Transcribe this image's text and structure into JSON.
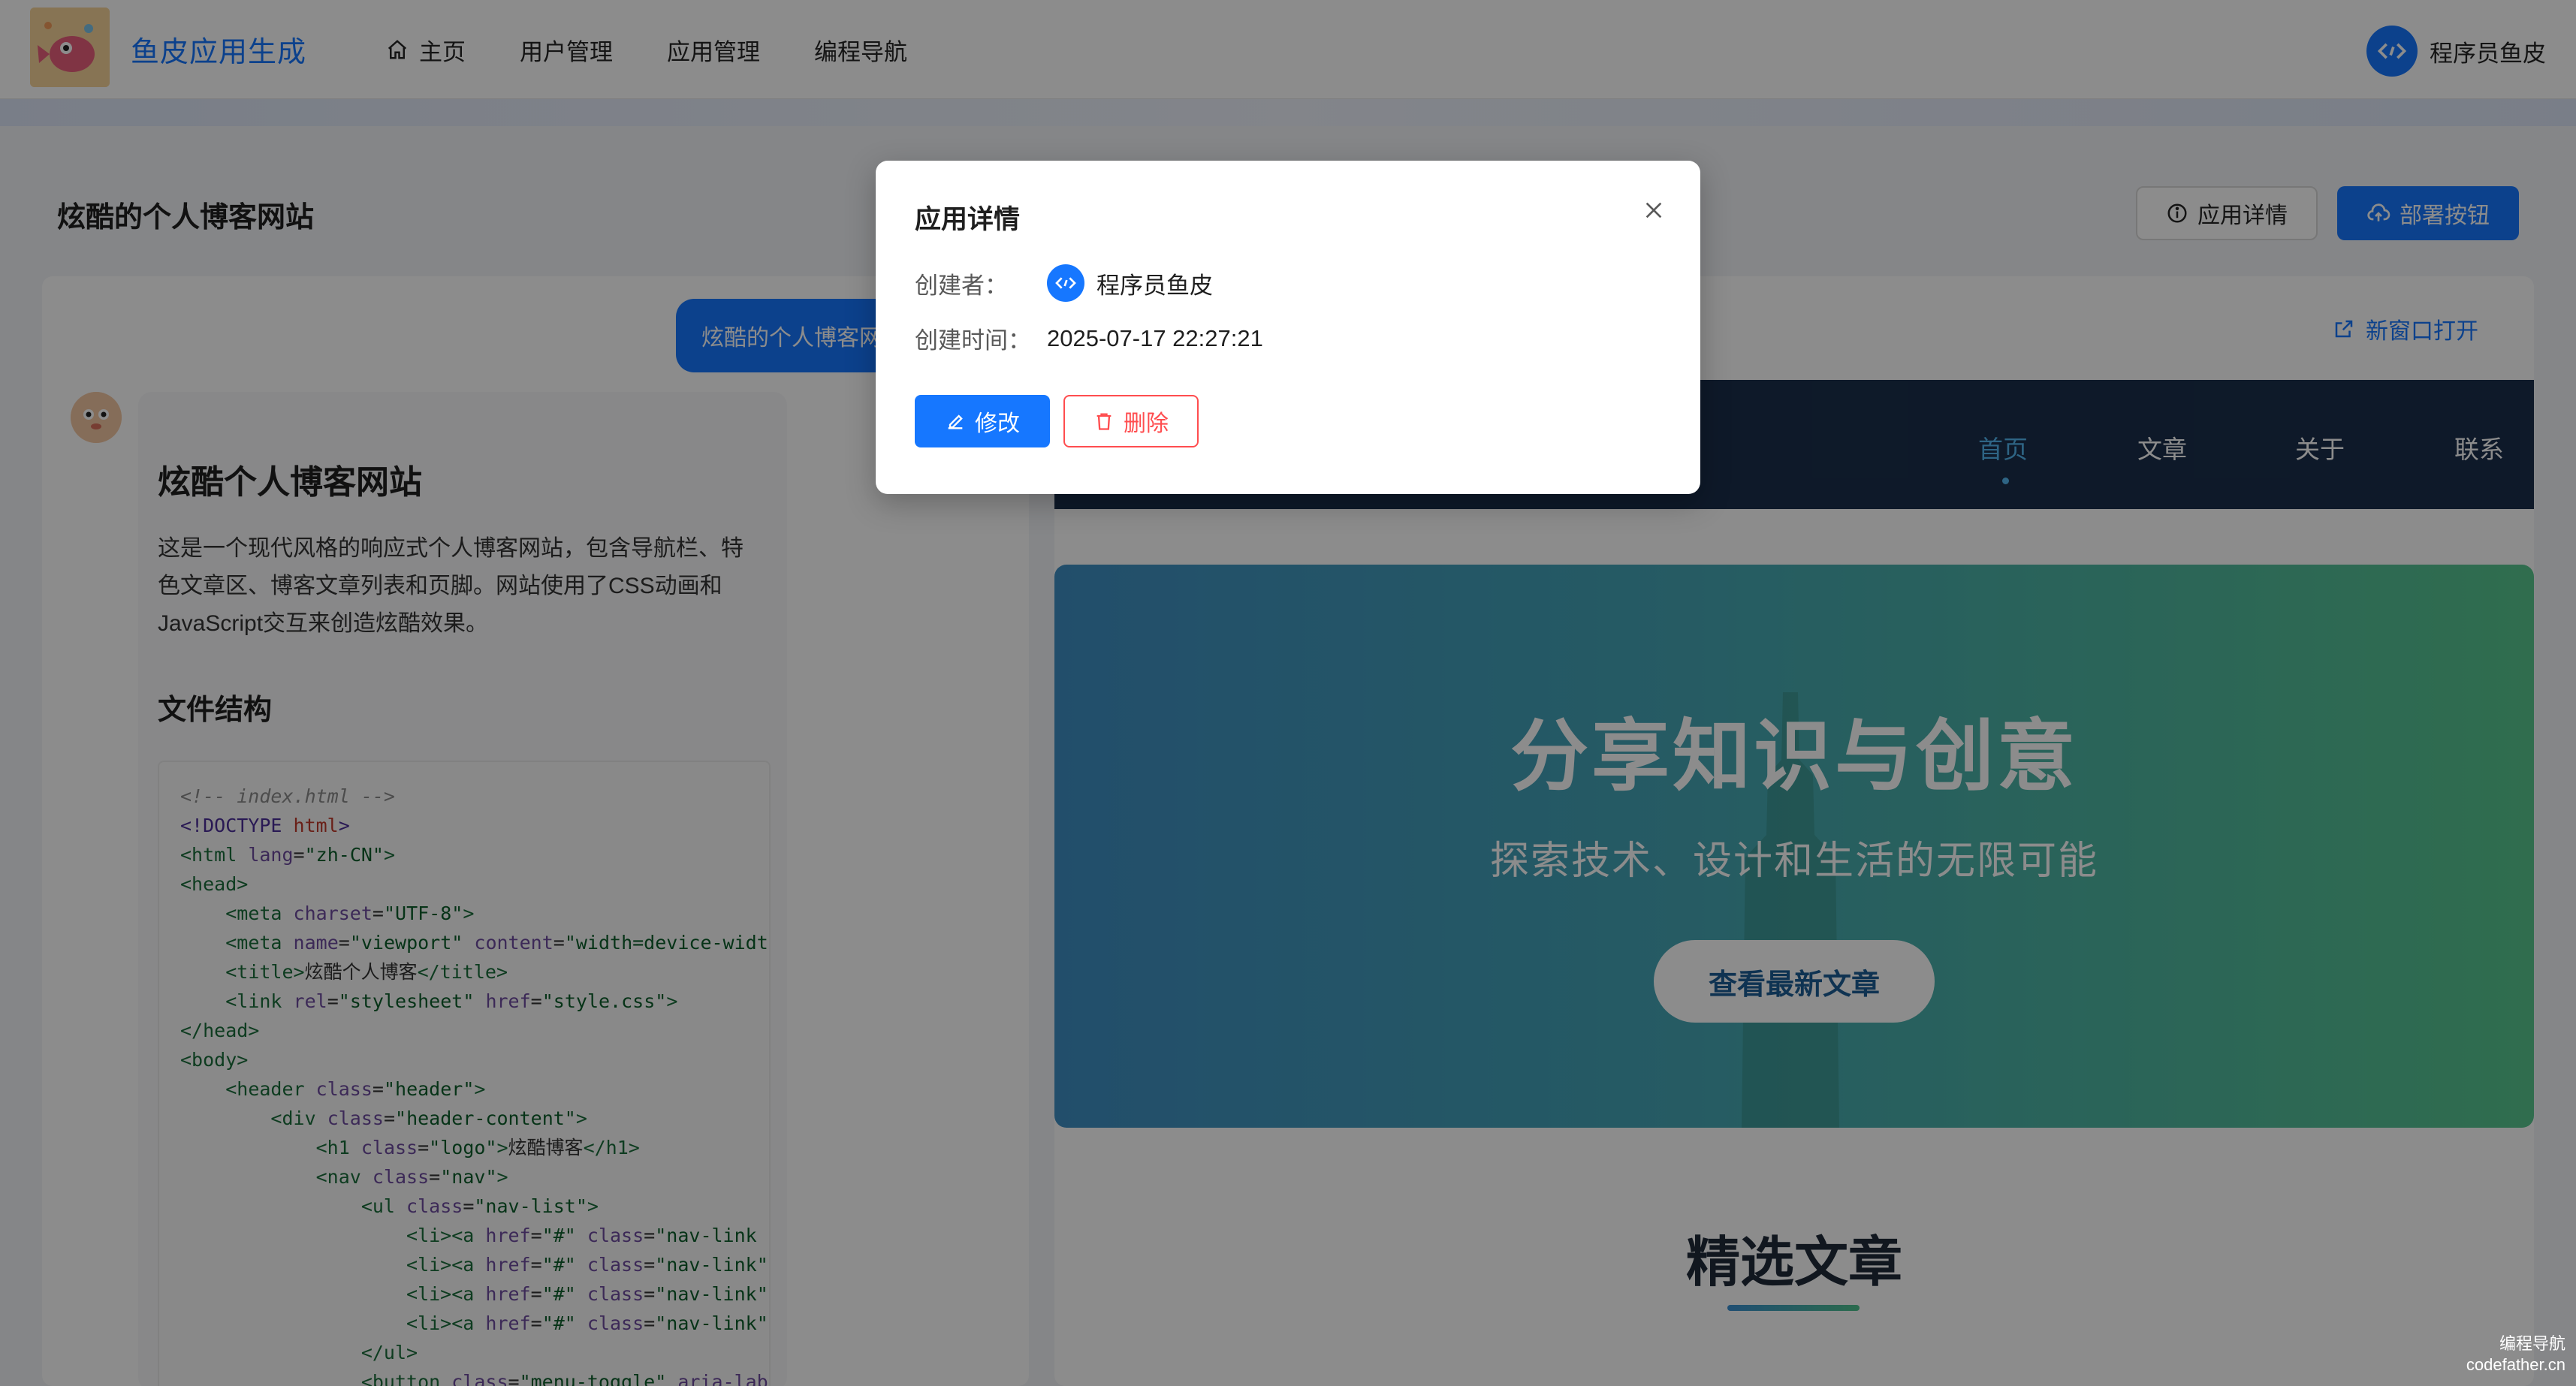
{
  "header": {
    "brand": "鱼皮应用生成",
    "nav": [
      {
        "label": "主页",
        "icon": "home-icon"
      },
      {
        "label": "用户管理"
      },
      {
        "label": "应用管理"
      },
      {
        "label": "编程导航"
      }
    ],
    "user_name": "程序员鱼皮"
  },
  "page": {
    "title": "炫酷的个人博客网站",
    "detail_button": "应用详情",
    "deploy_button": "部署按钮"
  },
  "chat": {
    "user_message": "炫酷的个人博客网站",
    "ai": {
      "heading": "炫酷个人博客网站",
      "description": "这是一个现代风格的响应式个人博客网站，包含导航栏、特色文章区、博客文章列表和页脚。网站使用了CSS动画和JavaScript交互来创造炫酷效果。",
      "section_title": "文件结构"
    }
  },
  "preview": {
    "open_new_window": "新窗口打开",
    "site_nav": [
      "首页",
      "文章",
      "关于",
      "联系"
    ],
    "hero_title": "分享知识与创意",
    "hero_subtitle": "探索技术、设计和生活的无限可能",
    "hero_button": "查看最新文章",
    "featured_title": "精选文章"
  },
  "modal": {
    "title": "应用详情",
    "creator_label": "创建者：",
    "creator_name": "程序员鱼皮",
    "created_label": "创建时间：",
    "created_time": "2025-07-17 22:27:21",
    "edit_button": "修改",
    "delete_button": "删除"
  },
  "watermark": {
    "line1": "编程导航",
    "line2": "codefather.cn"
  },
  "colors": {
    "primary": "#1677ff",
    "danger": "#ff4d4f",
    "site_nav_bg": "#1a2f4b"
  }
}
